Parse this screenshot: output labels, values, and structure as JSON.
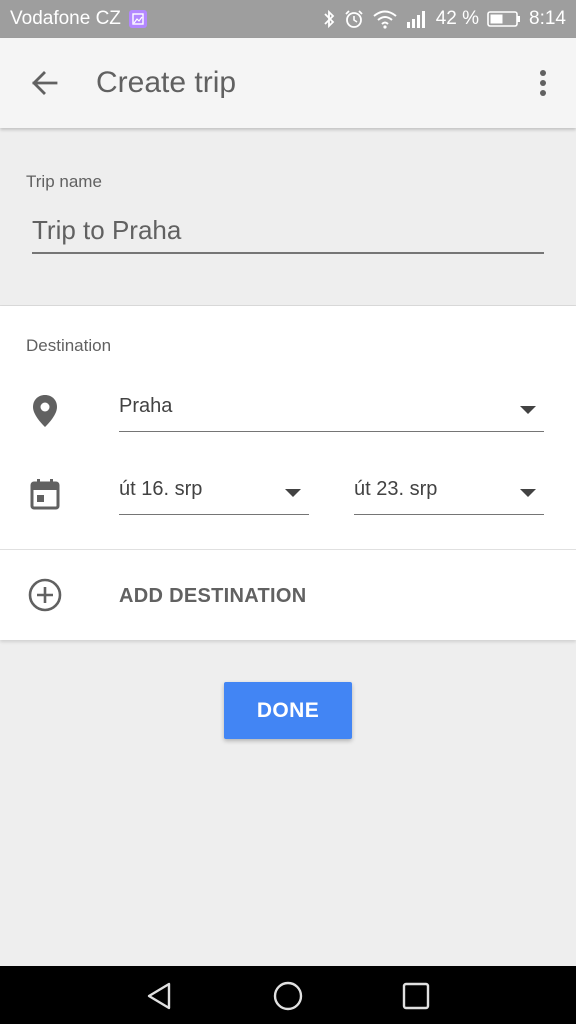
{
  "status_bar": {
    "carrier": "Vodafone CZ",
    "battery_percent": "42 %",
    "time": "8:14",
    "icons": [
      "gallery-icon",
      "bluetooth-icon",
      "alarm-icon",
      "wifi-icon",
      "signal-icon",
      "battery-icon"
    ]
  },
  "app_bar": {
    "title": "Create trip",
    "back_icon": "arrow-back-icon",
    "menu_icon": "more-vert-icon"
  },
  "trip": {
    "label": "Trip name",
    "value": "Trip to Praha"
  },
  "destination": {
    "label": "Destination",
    "place": "Praha",
    "start_date": "út 16. srp",
    "end_date": "út 23. srp",
    "add_label": "ADD DESTINATION"
  },
  "actions": {
    "done_label": "DONE"
  },
  "colors": {
    "accent": "#4285f4",
    "status_bar": "#9e9e9e",
    "nav_bar": "#000000"
  }
}
